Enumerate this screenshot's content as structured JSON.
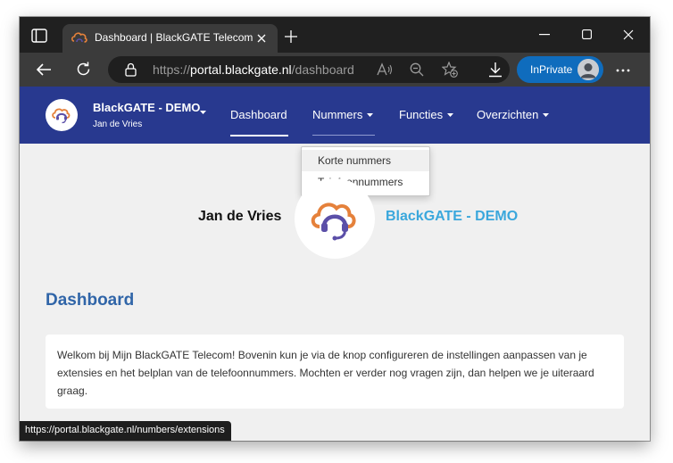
{
  "browser": {
    "tab": {
      "title": "Dashboard | BlackGATE Telecom"
    },
    "address": {
      "scheme": "https://",
      "host": "portal.blackgate.nl",
      "path": "/dashboard"
    },
    "inprivate_label": "InPrivate",
    "status_url": "https://portal.blackgate.nl/numbers/extensions",
    "icons": [
      "tab-actions-icon",
      "favicon-icon",
      "close-icon",
      "plus-icon",
      "minimize-icon",
      "maximize-icon",
      "close-window-icon",
      "back-arrow-icon",
      "refresh-icon",
      "lock-icon",
      "read-aloud-icon",
      "zoom-out-icon",
      "add-favorite-icon",
      "download-icon",
      "avatar-icon",
      "more-dots-icon"
    ]
  },
  "site": {
    "brand_color": "#28398f",
    "account": {
      "name": "BlackGATE - DEMO",
      "user": "Jan de Vries"
    },
    "nav": {
      "dashboard": "Dashboard",
      "nummers": "Nummers",
      "functies": "Functies",
      "overzichten": "Overzichten"
    },
    "dropdown": [
      "Korte nummers",
      "Telefoonnummers"
    ]
  },
  "profile": {
    "name": "Jan de Vries",
    "company": "BlackGATE - DEMO",
    "company_color": "#3aa7dc"
  },
  "main": {
    "title": "Dashboard",
    "title_color": "#3065a8",
    "welcome": "Welkom bij Mijn BlackGATE Telecom! Bovenin kun je via de knop configureren de instellingen aanpassen van je extensies en het belplan van de telefoonnummers. Mochten er verder nog vragen zijn, dan helpen we je uiteraard graag."
  }
}
